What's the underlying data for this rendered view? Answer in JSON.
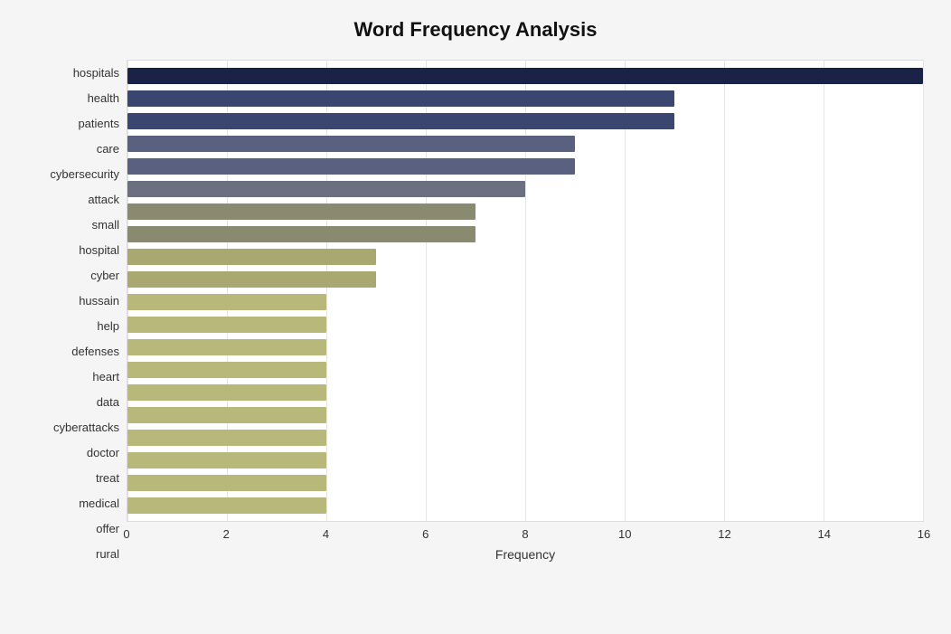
{
  "title": "Word Frequency Analysis",
  "x_axis_label": "Frequency",
  "x_ticks": [
    0,
    2,
    4,
    6,
    8,
    10,
    12,
    14,
    16
  ],
  "max_value": 16,
  "bars": [
    {
      "label": "hospitals",
      "value": 16,
      "color": "#1a2347"
    },
    {
      "label": "health",
      "value": 11,
      "color": "#3a4570"
    },
    {
      "label": "patients",
      "value": 11,
      "color": "#3a4570"
    },
    {
      "label": "care",
      "value": 9,
      "color": "#5a6080"
    },
    {
      "label": "cybersecurity",
      "value": 9,
      "color": "#5a6080"
    },
    {
      "label": "attack",
      "value": 8,
      "color": "#6b7080"
    },
    {
      "label": "small",
      "value": 7,
      "color": "#8a8a70"
    },
    {
      "label": "hospital",
      "value": 7,
      "color": "#8a8a70"
    },
    {
      "label": "cyber",
      "value": 5,
      "color": "#a8a870"
    },
    {
      "label": "hussain",
      "value": 5,
      "color": "#a8a870"
    },
    {
      "label": "help",
      "value": 4,
      "color": "#b8b87a"
    },
    {
      "label": "defenses",
      "value": 4,
      "color": "#b8b87a"
    },
    {
      "label": "heart",
      "value": 4,
      "color": "#b8b87a"
    },
    {
      "label": "data",
      "value": 4,
      "color": "#b8b87a"
    },
    {
      "label": "cyberattacks",
      "value": 4,
      "color": "#b8b87a"
    },
    {
      "label": "doctor",
      "value": 4,
      "color": "#b8b87a"
    },
    {
      "label": "treat",
      "value": 4,
      "color": "#b8b87a"
    },
    {
      "label": "medical",
      "value": 4,
      "color": "#b8b87a"
    },
    {
      "label": "offer",
      "value": 4,
      "color": "#b8b87a"
    },
    {
      "label": "rural",
      "value": 4,
      "color": "#b8b87a"
    }
  ]
}
